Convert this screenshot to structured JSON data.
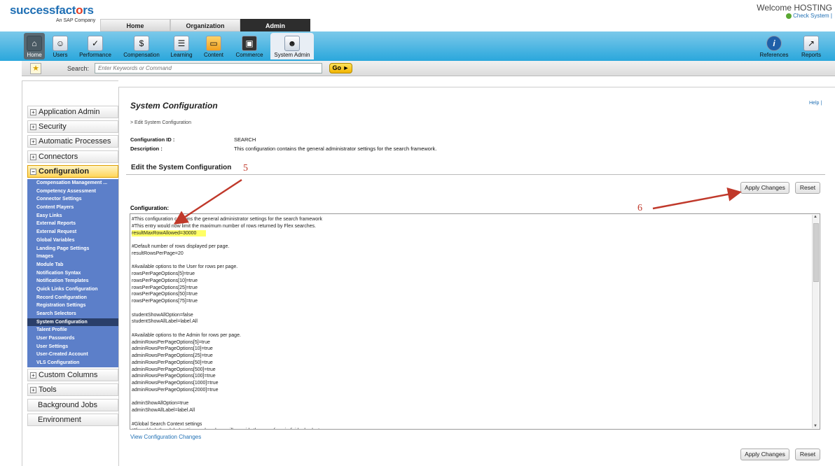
{
  "logo": {
    "brand": "successfactors",
    "tagline": "An SAP Company"
  },
  "top_tabs": [
    "Home",
    "Organization",
    "Admin"
  ],
  "welcome": "Welcome HOSTING",
  "check_system": "Check System |",
  "nav": [
    "Home",
    "Users",
    "Performance",
    "Compensation",
    "Learning",
    "Content",
    "Commerce",
    "System Admin"
  ],
  "nav_right": [
    "References",
    "Reports"
  ],
  "search": {
    "label": "Search:",
    "placeholder": "Enter Keywords or Command",
    "go": "Go"
  },
  "sidebar": {
    "top_items": [
      "Application Admin",
      "Security",
      "Automatic Processes",
      "Connectors",
      "Configuration"
    ],
    "config_subitems": [
      "Compensation Management ...",
      "Competency Assessment",
      "Connector Settings",
      "Content Players",
      "Easy Links",
      "External Reports",
      "External Request",
      "Global Variables",
      "Landing Page Settings",
      "Images",
      "Module Tab",
      "Notification Syntax",
      "Notification Templates",
      "Quick Links Configuration",
      "Record Configuration",
      "Registration Settings",
      "Search Selectors",
      "System Configuration",
      "Talent Profile",
      "User Passwords",
      "User Settings",
      "User-Created Account",
      "VLS Configuration"
    ],
    "bottom_items": [
      "Custom Columns",
      "Tools",
      "Background Jobs",
      "Environment"
    ]
  },
  "main": {
    "title": "System Configuration",
    "help": "Help |",
    "breadcrumb": "> Edit System Configuration",
    "config_id_label": "Configuration ID :",
    "config_id_value": "SEARCH",
    "description_label": "Description :",
    "description_value": "This configuration contains the general administrator settings for the search framework.",
    "edit_heading": "Edit the System Configuration",
    "apply_label": "Apply Changes",
    "reset_label": "Reset",
    "configuration_label": "Configuration:",
    "code_lines": [
      "#This configuration contains the general administrator settings for the search framework",
      "#This entry would now limit the maximum number of rows returned by Flex searches.",
      "resultMaxRowAllowed=30000",
      "",
      "#Default number of rows displayed per page.",
      "resultRowsPerPage=20",
      "",
      "#Available options to the User for rows per page.",
      "rowsPerPageOptions[5]=true",
      "rowsPerPageOptions[10]=true",
      "rowsPerPageOptions[25]=true",
      "rowsPerPageOptions[50]=true",
      "rowsPerPageOptions[75]=true",
      "",
      "studentShowAllOption=false",
      "studentShowAllLabel=label.All",
      "",
      "#Available options to the Admin for rows per page.",
      "adminRowsPerPageOptions[5]=true",
      "adminRowsPerPageOptions[10]=true",
      "adminRowsPerPageOptions[25]=true",
      "adminRowsPerPageOptions[50]=true",
      "adminRowsPerPageOptions[500]=true",
      "adminRowsPerPageOptions[100]=true",
      "adminRowsPerPageOptions[1000]=true",
      "adminRowsPerPageOptions[2000]=true",
      "",
      "adminShowAllOption=true",
      "adminShowAllLabel=label.All",
      "",
      "#Global Search Context settings",
      "#If enabled, the global settings values here will override the ones from individual selectors"
    ],
    "view_changes": "View Configuration Changes"
  },
  "annotations": {
    "step5": "5",
    "step6": "6",
    "accent": "#c0392b"
  }
}
